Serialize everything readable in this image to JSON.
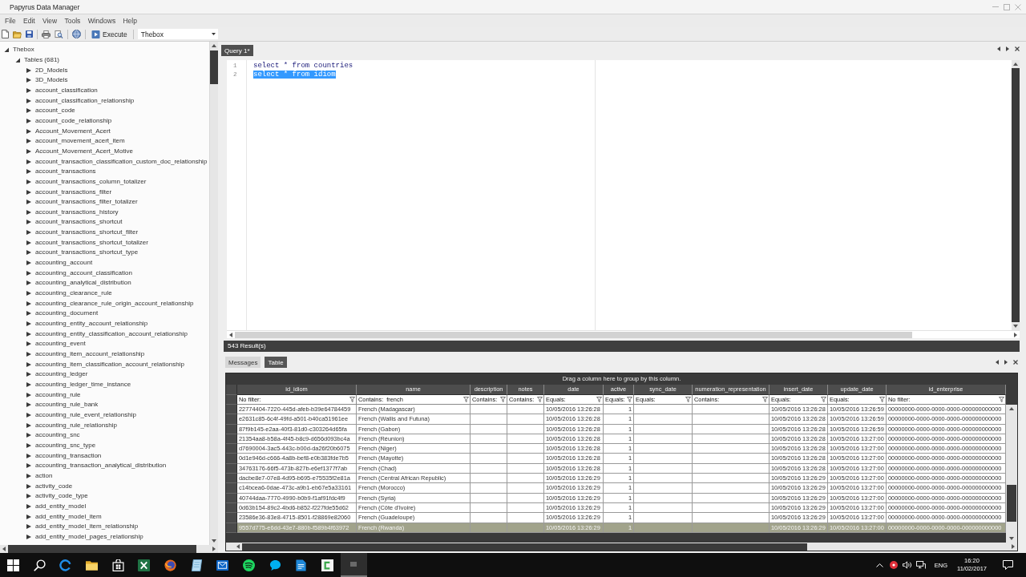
{
  "window": {
    "title": "Papyrus Data Manager"
  },
  "menu": [
    "File",
    "Edit",
    "View",
    "Tools",
    "Windows",
    "Help"
  ],
  "toolbar": {
    "execute_label": "Execute",
    "database": "Thebox"
  },
  "tree": [
    {
      "label": "Thebox",
      "expanded": true,
      "children": [
        {
          "label": "Tables (681)",
          "expanded": true,
          "children": [
            {
              "label": "2D_Models",
              "expanded": false
            },
            {
              "label": "3D_Models",
              "expanded": false
            },
            {
              "label": "account_classification",
              "expanded": false
            },
            {
              "label": "account_classification_relationship",
              "expanded": false
            },
            {
              "label": "account_code",
              "expanded": false
            },
            {
              "label": "account_code_relationship",
              "expanded": false
            },
            {
              "label": "Account_Movement_Acert",
              "expanded": false
            },
            {
              "label": "account_movement_acert_item",
              "expanded": false
            },
            {
              "label": "Account_Movement_Acert_Motive",
              "expanded": false
            },
            {
              "label": "account_transaction_classification_custom_doc_relationship",
              "expanded": false
            },
            {
              "label": "account_transactions",
              "expanded": false
            },
            {
              "label": "account_transactions_column_totalizer",
              "expanded": false
            },
            {
              "label": "account_transactions_filter",
              "expanded": false
            },
            {
              "label": "account_transactions_filter_totalizer",
              "expanded": false
            },
            {
              "label": "account_transactions_history",
              "expanded": false
            },
            {
              "label": "account_transactions_shortcut",
              "expanded": false
            },
            {
              "label": "account_transactions_shortcut_filter",
              "expanded": false
            },
            {
              "label": "account_transactions_shortcut_totalizer",
              "expanded": false
            },
            {
              "label": "account_transactions_shortcut_type",
              "expanded": false
            },
            {
              "label": "accounting_account",
              "expanded": false
            },
            {
              "label": "accounting_account_classification",
              "expanded": false
            },
            {
              "label": "accounting_analytical_distribution",
              "expanded": false
            },
            {
              "label": "accounting_clearance_rule",
              "expanded": false
            },
            {
              "label": "accounting_clearance_rule_origin_account_relationship",
              "expanded": false
            },
            {
              "label": "accounting_document",
              "expanded": false
            },
            {
              "label": "accounting_entity_account_relationship",
              "expanded": false
            },
            {
              "label": "accounting_entity_classification_account_relationship",
              "expanded": false
            },
            {
              "label": "accounting_event",
              "expanded": false
            },
            {
              "label": "accounting_item_account_relationship",
              "expanded": false
            },
            {
              "label": "accounting_item_classification_account_relationship",
              "expanded": false
            },
            {
              "label": "accounting_ledger",
              "expanded": false
            },
            {
              "label": "accounting_ledger_time_instance",
              "expanded": false
            },
            {
              "label": "accounting_rule",
              "expanded": false
            },
            {
              "label": "accounting_rule_bank",
              "expanded": false
            },
            {
              "label": "accounting_rule_event_relationship",
              "expanded": false
            },
            {
              "label": "accounting_rule_relationship",
              "expanded": false
            },
            {
              "label": "accounting_snc",
              "expanded": false
            },
            {
              "label": "accounting_snc_type",
              "expanded": false
            },
            {
              "label": "accounting_transaction",
              "expanded": false
            },
            {
              "label": "accounting_transaction_analytical_distribution",
              "expanded": false
            },
            {
              "label": "action",
              "expanded": false
            },
            {
              "label": "activity_code",
              "expanded": false
            },
            {
              "label": "activity_code_type",
              "expanded": false
            },
            {
              "label": "add_entity_model",
              "expanded": false
            },
            {
              "label": "add_entity_model_item",
              "expanded": false
            },
            {
              "label": "add_entity_model_item_relationship",
              "expanded": false
            },
            {
              "label": "add_entity_model_pages_relationship",
              "expanded": false
            }
          ]
        }
      ]
    }
  ],
  "query_tabs": [
    {
      "label": "Query 1*",
      "selected": true
    }
  ],
  "editor": {
    "lines": [
      {
        "number": "1",
        "code": "select * from countries",
        "selected": false
      },
      {
        "number": "2",
        "code": "select * from idiom",
        "selected": true
      }
    ]
  },
  "result_count": "543 Result(s)",
  "result_tabs": [
    {
      "label": "Messages",
      "selected": false
    },
    {
      "label": "Table",
      "selected": true
    }
  ],
  "grid": {
    "group_hint": "Drag a column here to group by this column.",
    "columns": [
      {
        "label": "id_idiom",
        "filter": "No filter:"
      },
      {
        "label": "name",
        "filter": "Contains:",
        "filter_value": "french"
      },
      {
        "label": "description",
        "filter": "Contains:"
      },
      {
        "label": "notes",
        "filter": "Contains:"
      },
      {
        "label": "date",
        "filter": "Equals:"
      },
      {
        "label": "active",
        "filter": "Equals:"
      },
      {
        "label": "sync_date",
        "filter": "Equals:"
      },
      {
        "label": "numeration_representation",
        "filter": "Contains:"
      },
      {
        "label": "insert_date",
        "filter": "Equals:"
      },
      {
        "label": "update_date",
        "filter": "Equals:"
      },
      {
        "label": "id_enterprise",
        "filter": "No filter:"
      }
    ],
    "rows": [
      {
        "selected": false,
        "cells": [
          "22774404-7220-445d-afeb-b39e64784459",
          "French (Madagascar)",
          null,
          null,
          "10/05/2016 13:26:28",
          "1",
          null,
          null,
          "10/05/2016 13:26:28",
          "10/05/2016 13:26:59",
          "00000000-0000-0000-0000-000000000000"
        ]
      },
      {
        "selected": false,
        "cells": [
          "e2631c85-6c4f-49fd-a501-b40ca51961ee",
          "French (Wallis and Futuna)",
          null,
          null,
          "10/05/2016 13:26:28",
          "1",
          null,
          null,
          "10/05/2016 13:26:28",
          "10/05/2016 13:26:59",
          "00000000-0000-0000-0000-000000000000"
        ]
      },
      {
        "selected": false,
        "cells": [
          "87f9b145-e2aa-40f3-81d0-c303264d65fa",
          "French (Gabon)",
          null,
          null,
          "10/05/2016 13:26:28",
          "1",
          null,
          null,
          "10/05/2016 13:26:28",
          "10/05/2016 13:26:59",
          "00000000-0000-0000-0000-000000000000"
        ]
      },
      {
        "selected": false,
        "cells": [
          "21354aa8-b58a-4f45-b8c9-d656d093bc4a",
          "French (Réunion)",
          null,
          null,
          "10/05/2016 13:26:28",
          "1",
          null,
          null,
          "10/05/2016 13:26:28",
          "10/05/2016 13:27:00",
          "00000000-0000-0000-0000-000000000000"
        ]
      },
      {
        "selected": false,
        "cells": [
          "d7690004-3ac5-443c-b00d-da26f20b6075",
          "French (Niger)",
          null,
          null,
          "10/05/2016 13:26:28",
          "1",
          null,
          null,
          "10/05/2016 13:26:28",
          "10/05/2016 13:27:00",
          "00000000-0000-0000-0000-000000000000"
        ]
      },
      {
        "selected": false,
        "cells": [
          "0d1e946d-c666-4a8b-bef8-e0b383fde7b5",
          "French (Mayotte)",
          null,
          null,
          "10/05/2016 13:26:28",
          "1",
          null,
          null,
          "10/05/2016 13:26:28",
          "10/05/2016 13:27:00",
          "00000000-0000-0000-0000-000000000000"
        ]
      },
      {
        "selected": false,
        "cells": [
          "34763176-66f5-473b-827b-e6ef1377f7ab",
          "French (Chad)",
          null,
          null,
          "10/05/2016 13:26:28",
          "1",
          null,
          null,
          "10/05/2016 13:26:28",
          "10/05/2016 13:27:00",
          "00000000-0000-0000-0000-000000000000"
        ]
      },
      {
        "selected": false,
        "cells": [
          "dacbe8e7-07e8-4d95-b695-e75535f2e81a",
          "French (Central African Republic)",
          null,
          null,
          "10/05/2016 13:26:29",
          "1",
          null,
          null,
          "10/05/2016 13:26:29",
          "10/05/2016 13:27:00",
          "00000000-0000-0000-0000-000000000000"
        ]
      },
      {
        "selected": false,
        "cells": [
          "c14bcea6-0dae-473c-a9b1-eb67e5a33161",
          "French (Morocco)",
          null,
          null,
          "10/05/2016 13:26:29",
          "1",
          null,
          null,
          "10/05/2016 13:26:29",
          "10/05/2016 13:27:00",
          "00000000-0000-0000-0000-000000000000"
        ]
      },
      {
        "selected": false,
        "cells": [
          "40744daa-7770-4990-b0b9-f1af91fdc4f9",
          "French (Syria)",
          null,
          null,
          "10/05/2016 13:26:29",
          "1",
          null,
          null,
          "10/05/2016 13:26:29",
          "10/05/2016 13:27:00",
          "00000000-0000-0000-0000-000000000000"
        ]
      },
      {
        "selected": false,
        "cells": [
          "0d63b154-89c2-4bd6-b852-f227fde55d62",
          "French (Côte d'Ivoire)",
          null,
          null,
          "10/05/2016 13:26:29",
          "1",
          null,
          null,
          "10/05/2016 13:26:29",
          "10/05/2016 13:27:00",
          "00000000-0000-0000-0000-000000000000"
        ]
      },
      {
        "selected": false,
        "cells": [
          "23586e36-83e8-4715-8501-f28869e82060",
          "French (Guadeloupe)",
          null,
          null,
          "10/05/2016 13:26:29",
          "1",
          null,
          null,
          "10/05/2016 13:26:29",
          "10/05/2016 13:27:00",
          "00000000-0000-0000-0000-000000000000"
        ]
      },
      {
        "selected": true,
        "cells": [
          "9557d775-e6dd-43e7-880b-f589b4f63972",
          "French (Rwanda)",
          null,
          null,
          "10/05/2016 13:26:29",
          "1",
          null,
          null,
          "10/05/2016 13:26:29",
          "10/05/2016 13:27:00",
          "00000000-0000-0000-0000-000000000000"
        ]
      }
    ]
  },
  "taskbar": {
    "language": "ENG",
    "time": "16:20",
    "date": "11/02/2017"
  }
}
